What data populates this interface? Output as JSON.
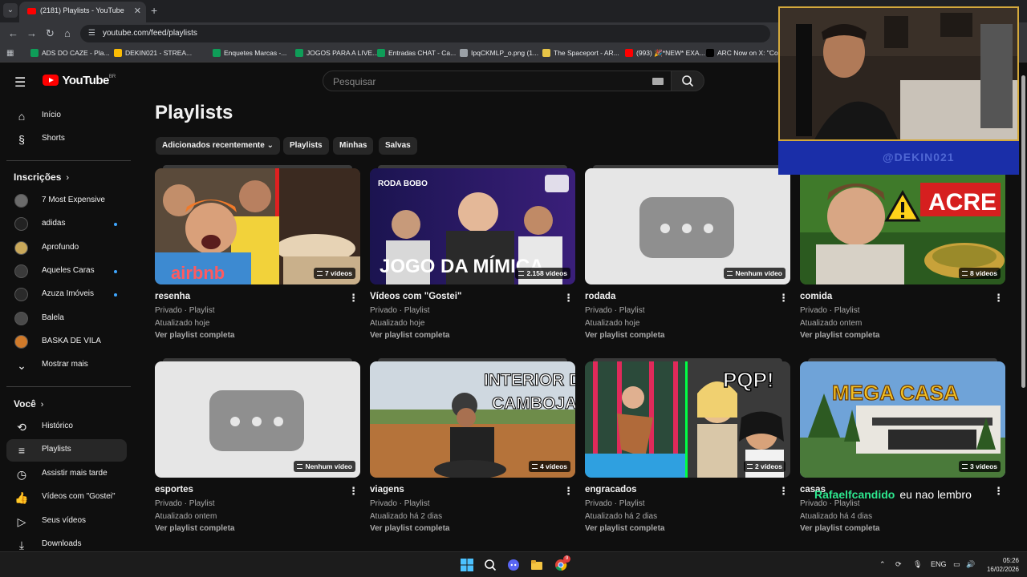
{
  "browser": {
    "tab_title": "(2181) Playlists - YouTube",
    "url": "youtube.com/feed/playlists",
    "bookmarks": [
      {
        "label": "ADS DO CAZE - Pla...",
        "color": "#0f9d58"
      },
      {
        "label": "DEKIN021 - STREA...",
        "color": "#fbbc04"
      },
      {
        "label": "Enquetes Marcas -...",
        "color": "#0f9d58"
      },
      {
        "label": "JOGOS PARA A LIVE...",
        "color": "#0f9d58"
      },
      {
        "label": "Entradas CHAT - Ca...",
        "color": "#0f9d58"
      },
      {
        "label": "IpqCKMLP_o.png (1...",
        "color": "#9aa0a6"
      },
      {
        "label": "The Spaceport - AR...",
        "color": "#e8c547"
      },
      {
        "label": "(993) 🎉*NEW* EXA...",
        "color": "#ff0000"
      },
      {
        "label": "ARC Now on X: \"Co...",
        "color": "#000000"
      }
    ]
  },
  "header": {
    "logo_text": "YouTube",
    "country_code": "BR",
    "search_placeholder": "Pesquisar"
  },
  "sidebar": {
    "main": [
      {
        "label": "Início",
        "icon": "home-icon"
      },
      {
        "label": "Shorts",
        "icon": "shorts-icon"
      }
    ],
    "subscriptions_title": "Inscrições",
    "subscriptions": [
      {
        "label": "7 Most Expensive",
        "color": "#6b6b6b",
        "dot": false
      },
      {
        "label": "adidas",
        "color": "#222222",
        "dot": true
      },
      {
        "label": "Aprofundo",
        "color": "#c9a85a",
        "dot": false
      },
      {
        "label": "Aqueles Caras",
        "color": "#3a3a3a",
        "dot": true
      },
      {
        "label": "Azuza Imóveis",
        "color": "#2a2a2a",
        "dot": true
      },
      {
        "label": "Balela",
        "color": "#4a4a4a",
        "dot": false
      },
      {
        "label": "BASKA DE VILA",
        "color": "#d07a2a",
        "dot": false
      }
    ],
    "show_more": "Mostrar mais",
    "you_title": "Você",
    "you_items": [
      {
        "label": "Histórico",
        "icon": "history-icon",
        "active": false
      },
      {
        "label": "Playlists",
        "icon": "playlists-icon",
        "active": true
      },
      {
        "label": "Assistir mais tarde",
        "icon": "watch-later-icon",
        "active": false
      },
      {
        "label": "Vídeos com \"Gostei\"",
        "icon": "like-icon",
        "active": false
      },
      {
        "label": "Seus vídeos",
        "icon": "your-videos-icon",
        "active": false
      },
      {
        "label": "Downloads",
        "icon": "download-icon",
        "active": false
      }
    ]
  },
  "main": {
    "title": "Playlists",
    "chips": [
      "Adicionados recentemente",
      "Playlists",
      "Minhas",
      "Salvas"
    ],
    "view_full": "Ver playlist completa",
    "cards": [
      {
        "title": "resenha",
        "meta": "Privado · Playlist",
        "updated": "Atualizado hoje",
        "count": "7 vídeos",
        "thumb": "t1",
        "thumb_text": "airbnb"
      },
      {
        "title": "Vídeos com \"Gostei\"",
        "meta": "Privado · Playlist",
        "updated": "Atualizado hoje",
        "count": "2.158 vídeos",
        "thumb": "t2",
        "thumb_text": "JOGO DA MÍMICA",
        "thumb_tag": "RODA BOBO"
      },
      {
        "title": "rodada",
        "meta": "Privado · Playlist",
        "updated": "Atualizado hoje",
        "count": "Nenhum vídeo",
        "thumb": "empty"
      },
      {
        "title": "comida",
        "meta": "Privado · Playlist",
        "updated": "Atualizado ontem",
        "count": "8 vídeos",
        "thumb": "t4",
        "thumb_text": "ACRE"
      },
      {
        "title": "esportes",
        "meta": "Privado · Playlist",
        "updated": "Atualizado ontem",
        "count": "Nenhum vídeo",
        "thumb": "empty"
      },
      {
        "title": "viagens",
        "meta": "Privado · Playlist",
        "updated": "Atualizado há 2 dias",
        "count": "4 vídeos",
        "thumb": "t6",
        "thumb_text": "INTERIOR DO CAMBOJA"
      },
      {
        "title": "engracados",
        "meta": "Privado · Playlist",
        "updated": "Atualizado há 2 dias",
        "count": "2 vídeos",
        "thumb": "t7",
        "thumb_text": "PQP!"
      },
      {
        "title": "casas",
        "meta": "Privado · Playlist",
        "updated": "Atualizado há 4 dias",
        "count": "3 vídeos",
        "thumb": "t8",
        "thumb_text": "MEGA CASA"
      }
    ]
  },
  "overlay": {
    "cam_handle": "@DEKIN021",
    "chat_user": "Rafaelfcandido",
    "chat_msg": "eu nao lembro"
  },
  "taskbar": {
    "lang": "ENG",
    "time": "05:26",
    "date": "16/02/2026",
    "badge": "9"
  }
}
